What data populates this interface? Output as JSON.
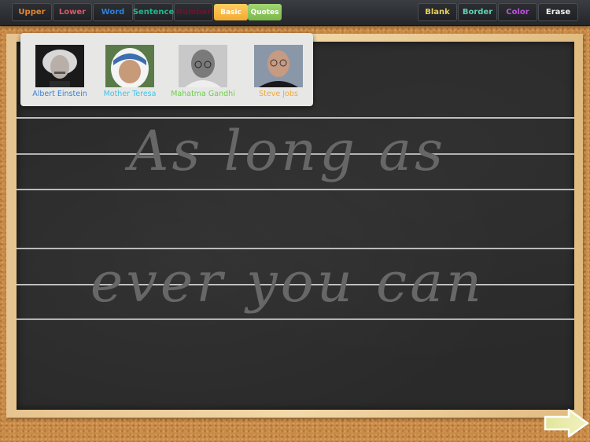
{
  "toolbar": {
    "left_buttons": [
      {
        "label": "Upper",
        "color": "#e8872a"
      },
      {
        "label": "Lower",
        "color": "#d9596a"
      },
      {
        "label": "Word",
        "color": "#2d7fd8"
      },
      {
        "label": "Sentence",
        "color": "#22b88a"
      },
      {
        "label": "Number",
        "color": "#6e1230"
      }
    ],
    "mode_buttons": [
      {
        "label": "Basic",
        "color": "#f7b43a"
      },
      {
        "label": "Quotes",
        "color": "#86c255"
      }
    ],
    "right_buttons": [
      {
        "label": "Blank",
        "color": "#e7d25a"
      },
      {
        "label": "Border",
        "color": "#5fd2b0"
      },
      {
        "label": "Color",
        "color": "#c24fe0"
      },
      {
        "label": "Erase",
        "color": "#f2f2f2"
      }
    ]
  },
  "quotes_popup": {
    "people": [
      {
        "name": "Albert Einstein",
        "color": "#3a7fd6",
        "icon": "einstein-portrait"
      },
      {
        "name": "Mother Teresa",
        "color": "#3ec2ea",
        "icon": "mother-teresa-portrait"
      },
      {
        "name": "Mahatma Gandhi",
        "color": "#6ccf4a",
        "icon": "gandhi-portrait"
      },
      {
        "name": "Steve Jobs",
        "color": "#f2a63a",
        "icon": "steve-jobs-portrait"
      }
    ]
  },
  "board": {
    "lines": [
      "As long as",
      "ever you can"
    ]
  },
  "navigation": {
    "next_icon": "right-arrow-icon"
  }
}
